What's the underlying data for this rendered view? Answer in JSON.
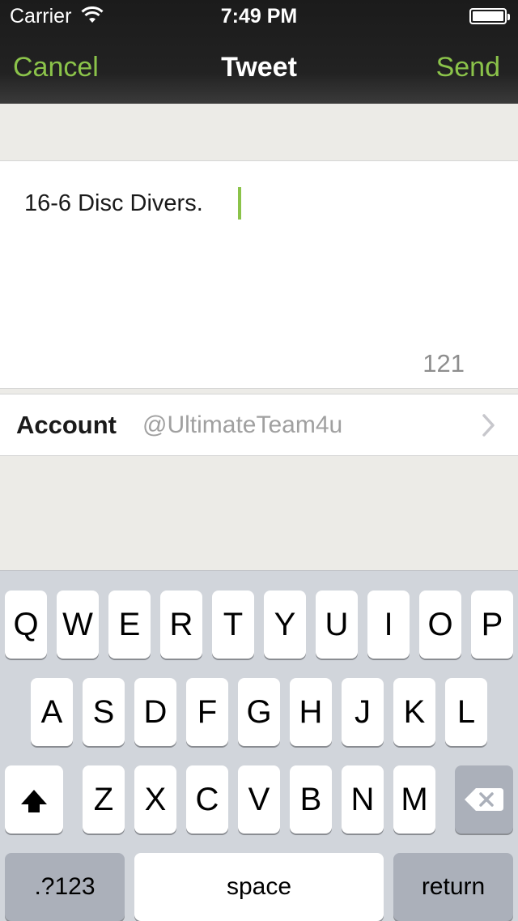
{
  "status_bar": {
    "carrier": "Carrier",
    "time": "7:49 PM"
  },
  "nav": {
    "cancel_label": "Cancel",
    "title": "Tweet",
    "send_label": "Send"
  },
  "compose": {
    "text": "16-6 Disc Divers.",
    "char_count": "121"
  },
  "account": {
    "label": "Account",
    "value": "@UltimateTeam4u"
  },
  "keyboard": {
    "row1": [
      "Q",
      "W",
      "E",
      "R",
      "T",
      "Y",
      "U",
      "I",
      "O",
      "P"
    ],
    "row2": [
      "A",
      "S",
      "D",
      "F",
      "G",
      "H",
      "J",
      "K",
      "L"
    ],
    "row3": [
      "Z",
      "X",
      "C",
      "V",
      "B",
      "N",
      "M"
    ],
    "numbers_label": ".?123",
    "space_label": "space",
    "return_label": "return"
  },
  "colors": {
    "accent": "#8bc34a",
    "nav_bg": "#222222",
    "page_bg": "#ecebe7",
    "keyboard_bg": "#d1d5db"
  },
  "icons": [
    "wifi-icon",
    "battery-icon",
    "chevron-right-icon",
    "shift-icon",
    "backspace-icon"
  ]
}
